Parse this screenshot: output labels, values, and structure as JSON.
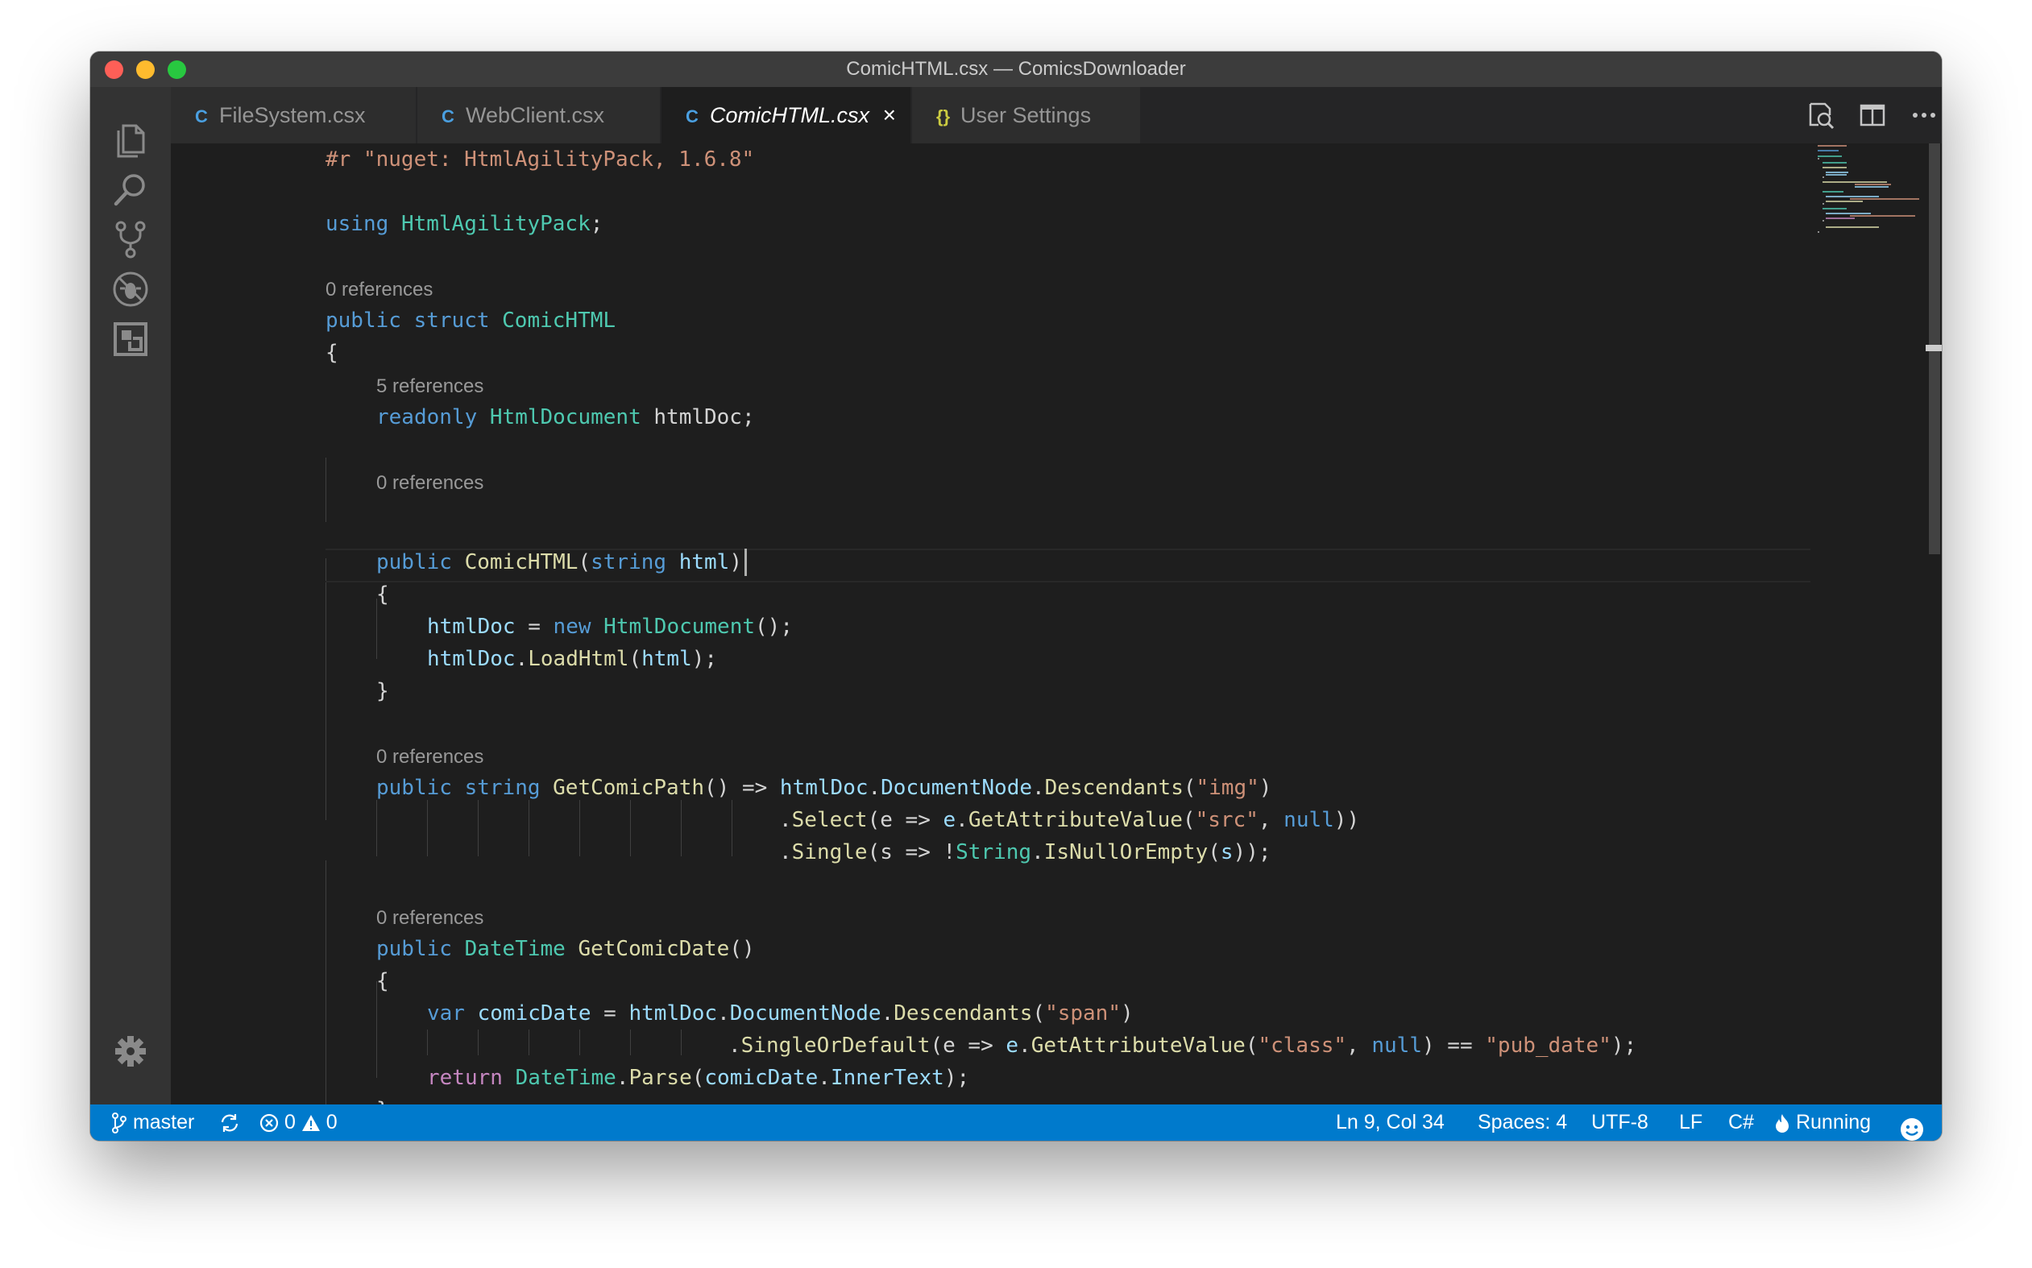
{
  "window": {
    "title": "ComicHTML.csx — ComicsDownloader"
  },
  "activity_bar": [
    "explorer-icon",
    "search-icon",
    "source-control-icon",
    "debug-icon",
    "extensions-icon",
    "settings-gear-icon"
  ],
  "tabs": [
    {
      "label": "FileSystem.csx",
      "icon": "csharp-icon",
      "active": false
    },
    {
      "label": "WebClient.csx",
      "icon": "csharp-icon",
      "active": false
    },
    {
      "label": "ComicHTML.csx",
      "icon": "csharp-icon",
      "active": true,
      "close": "×"
    },
    {
      "label": "User Settings",
      "icon": "json-icon",
      "active": false,
      "glyph": "{}"
    }
  ],
  "tab_actions": [
    "open-preview-icon",
    "split-editor-icon",
    "more-actions-icon"
  ],
  "code": {
    "directive": "#r \"nuget: HtmlAgilityPack, 1.6.8\"",
    "using_kw": "using",
    "using_ns": "HtmlAgilityPack",
    "semi": ";",
    "lens": [
      "0 references",
      "5 references",
      "0 references",
      "0 references",
      "0 references"
    ],
    "struct_line": {
      "kw1": "public",
      "kw2": "struct",
      "name": "ComicHTML"
    },
    "field_line": {
      "kw": "readonly",
      "type": "HtmlDocument",
      "name": "htmlDoc;"
    },
    "ctor_line": {
      "kw": "public",
      "name": "ComicHTML",
      "open": "(",
      "ptype": "string",
      "pname": "html",
      "close": ")"
    },
    "ctor_body1": {
      "var": "htmlDoc",
      "op": " = ",
      "kw": "new",
      "type": "HtmlDocument",
      "tail": "();"
    },
    "ctor_body2": {
      "var": "htmlDoc",
      "dot": ".",
      "fn": "LoadHtml",
      "open": "(",
      "arg": "html",
      "tail": ");"
    },
    "path_line": {
      "kw1": "public",
      "kw2": "string",
      "fn": "GetComicPath",
      "mid": "() => ",
      "v1": "htmlDoc",
      "v2": "DocumentNode",
      "fn2": "Descendants",
      "s": "\"img\""
    },
    "path_line2": {
      "fn": "Select",
      "p": "(e => ",
      "v": "e",
      "fn2": "GetAttributeValue",
      "s": "\"src\"",
      "kw": "null",
      "tail": "))"
    },
    "path_line3": {
      "fn": "Single",
      "p": "(s => !",
      "ty": "String",
      "fn2": "IsNullOrEmpty",
      "v": "s",
      "tail": "));"
    },
    "date_line": {
      "kw": "public",
      "type": "DateTime",
      "fn": "GetComicDate",
      "tail": "()"
    },
    "date_body1": {
      "kw": "var",
      "name": "comicDate",
      "op": " = ",
      "v1": "htmlDoc",
      "v2": "DocumentNode",
      "fn": "Descendants",
      "s": "\"span\""
    },
    "date_body2": {
      "fn": "SingleOrDefault",
      "p": "(e => ",
      "v": "e",
      "fn2": "GetAttributeValue",
      "s": "\"class\"",
      "kw": "null",
      "op": ") == ",
      "s2": "\"pub_date\"",
      "tail": ");"
    },
    "date_body3": {
      "kw": "return",
      "ty": "DateTime",
      "fn": "Parse",
      "v": "comicDate",
      "v2": "InnerText",
      "tail": ");"
    },
    "brace_open": "{",
    "brace_close": "}"
  },
  "status_bar": {
    "branch": "master",
    "errors": "0",
    "warnings": "0",
    "position": "Ln 9, Col 34",
    "spaces": "Spaces: 4",
    "encoding": "UTF-8",
    "eol": "LF",
    "language": "C#",
    "running": "Running"
  }
}
